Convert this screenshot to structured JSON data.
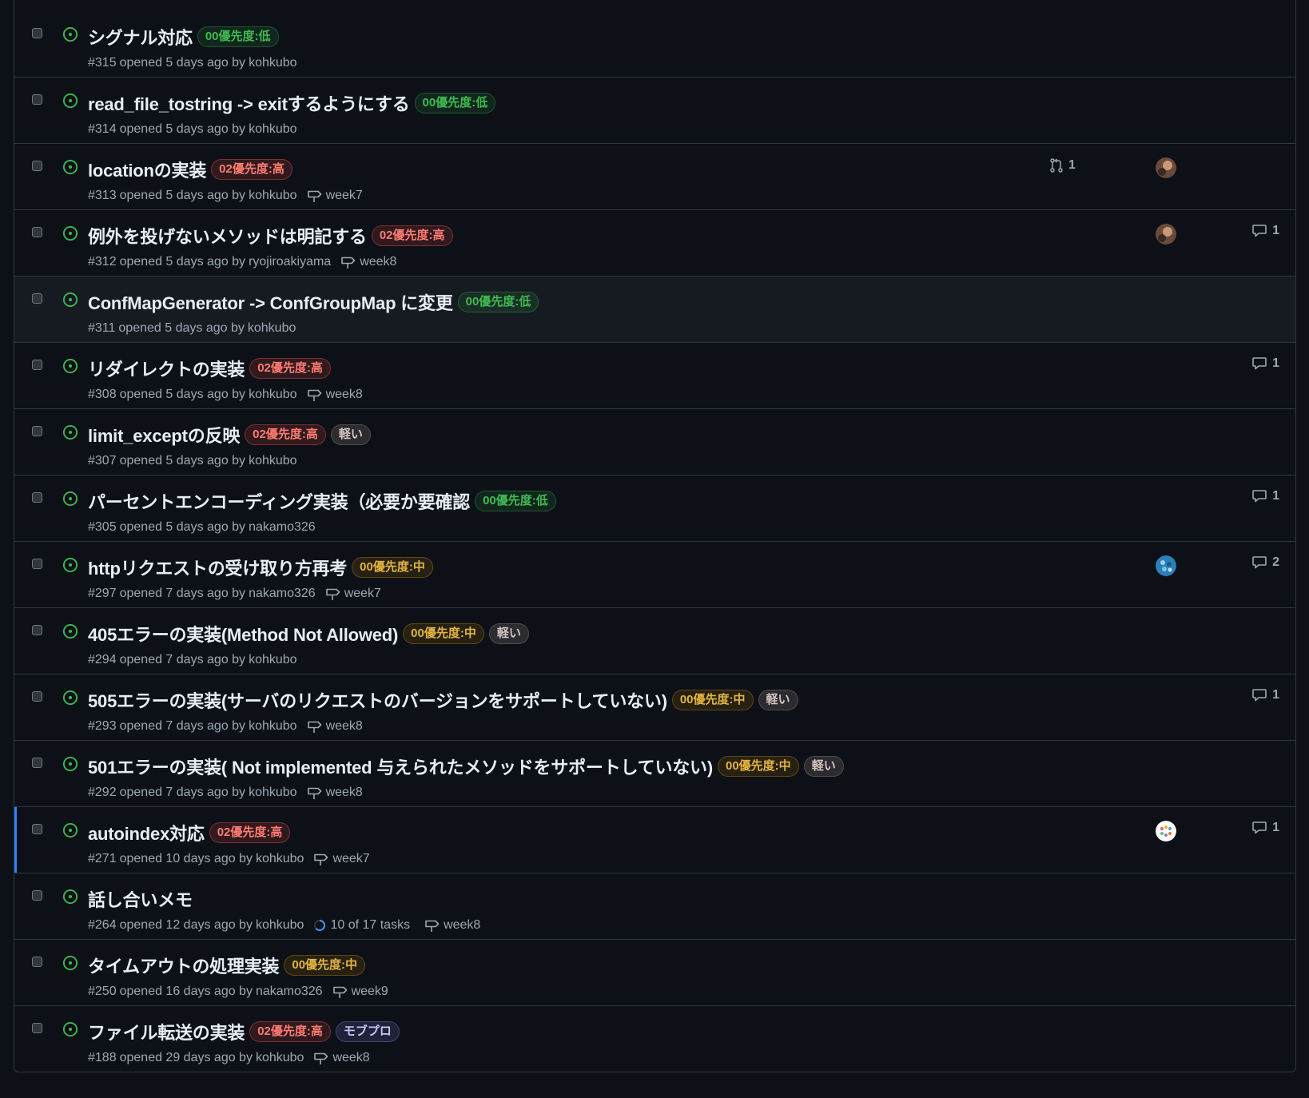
{
  "colors": {
    "low": {
      "text": "#3fb950",
      "border": "#2ea04366",
      "bg": "#2ea04326"
    },
    "high": {
      "text": "#ff7b72",
      "border": "#f8514966",
      "bg": "#f8514926"
    },
    "mid": {
      "text": "#e3b341",
      "border": "#bb800966",
      "bg": "#bb800926"
    },
    "light": {
      "text": "#d4c5c0",
      "border": "#8b7d7966",
      "bg": "#8b7d7940"
    },
    "mob": {
      "text": "#c9c3f5",
      "border": "#7e78c066",
      "bg": "#5c58a240"
    }
  },
  "issues": [
    {
      "title": "シグナル対応",
      "labels": [
        {
          "text": "00優先度:低",
          "kind": "low"
        }
      ],
      "number": "#315",
      "meta": "opened 5 days ago by",
      "author": "kohkubo"
    },
    {
      "title": "read_file_tostring -> exitするようにする",
      "labels": [
        {
          "text": "00優先度:低",
          "kind": "low"
        }
      ],
      "number": "#314",
      "meta": "opened 5 days ago by",
      "author": "kohkubo"
    },
    {
      "title": "locationの実装",
      "labels": [
        {
          "text": "02優先度:高",
          "kind": "high"
        }
      ],
      "number": "#313",
      "meta": "opened 5 days ago by",
      "author": "kohkubo",
      "milestone": "week7",
      "pr": "1",
      "avatar": "brown"
    },
    {
      "title": "例外を投げないメソッドは明記する",
      "labels": [
        {
          "text": "02優先度:高",
          "kind": "high"
        }
      ],
      "number": "#312",
      "meta": "opened 5 days ago by",
      "author": "ryojiroakiyama",
      "milestone": "week8",
      "avatar": "brown",
      "comments": "1"
    },
    {
      "title": "ConfMapGenerator -> ConfGroupMap に変更",
      "labels": [
        {
          "text": "00優先度:低",
          "kind": "low"
        }
      ],
      "number": "#311",
      "meta": "opened 5 days ago by",
      "author": "kohkubo",
      "hover": true
    },
    {
      "title": "リダイレクトの実装",
      "labels": [
        {
          "text": "02優先度:高",
          "kind": "high"
        }
      ],
      "number": "#308",
      "meta": "opened 5 days ago by",
      "author": "kohkubo",
      "milestone": "week8",
      "comments": "1"
    },
    {
      "title": "limit_exceptの反映",
      "labels": [
        {
          "text": "02優先度:高",
          "kind": "high"
        },
        {
          "text": "軽い",
          "kind": "light"
        }
      ],
      "number": "#307",
      "meta": "opened 5 days ago by",
      "author": "kohkubo"
    },
    {
      "title": "パーセントエンコーディング実装（必要か要確認",
      "labels": [
        {
          "text": "00優先度:低",
          "kind": "low"
        }
      ],
      "number": "#305",
      "meta": "opened 5 days ago by",
      "author": "nakamo326",
      "comments": "1"
    },
    {
      "title": "httpリクエストの受け取り方再考",
      "labels": [
        {
          "text": "00優先度:中",
          "kind": "mid"
        }
      ],
      "number": "#297",
      "meta": "opened 7 days ago by",
      "author": "nakamo326",
      "milestone": "week7",
      "avatar": "blue",
      "comments": "2"
    },
    {
      "title": "405エラーの実装(Method Not Allowed)",
      "labels": [
        {
          "text": "00優先度:中",
          "kind": "mid"
        },
        {
          "text": "軽い",
          "kind": "light"
        }
      ],
      "number": "#294",
      "meta": "opened 7 days ago by",
      "author": "kohkubo"
    },
    {
      "title": "505エラーの実装(サーバのリクエストのバージョンをサポートしていない)",
      "labels": [
        {
          "text": "00優先度:中",
          "kind": "mid"
        },
        {
          "text": "軽い",
          "kind": "light"
        }
      ],
      "number": "#293",
      "meta": "opened 7 days ago by",
      "author": "kohkubo",
      "milestone": "week8",
      "comments": "1"
    },
    {
      "title": "501エラーの実装( Not implemented 与えられたメソッドをサポートしていない)",
      "labels": [
        {
          "text": "00優先度:中",
          "kind": "mid"
        },
        {
          "text": "軽い",
          "kind": "light"
        }
      ],
      "number": "#292",
      "meta": "opened 7 days ago by",
      "author": "kohkubo",
      "milestone": "week8"
    },
    {
      "title": "autoindex対応",
      "labels": [
        {
          "text": "02優先度:高",
          "kind": "high"
        }
      ],
      "number": "#271",
      "meta": "opened 10 days ago by",
      "author": "kohkubo",
      "milestone": "week7",
      "avatar": "dots",
      "comments": "1",
      "active": true
    },
    {
      "title": "話し合いメモ",
      "labels": [],
      "number": "#264",
      "meta": "opened 12 days ago by",
      "author": "kohkubo",
      "tasks": "10 of 17 tasks",
      "milestone": "week8"
    },
    {
      "title": "タイムアウトの処理実装",
      "labels": [
        {
          "text": "00優先度:中",
          "kind": "mid"
        }
      ],
      "number": "#250",
      "meta": "opened 16 days ago by",
      "author": "nakamo326",
      "milestone": "week9"
    },
    {
      "title": "ファイル転送の実装",
      "labels": [
        {
          "text": "02優先度:高",
          "kind": "high"
        },
        {
          "text": "モブプロ",
          "kind": "mob"
        }
      ],
      "number": "#188",
      "meta": "opened 29 days ago by",
      "author": "kohkubo",
      "milestone": "week8"
    }
  ]
}
